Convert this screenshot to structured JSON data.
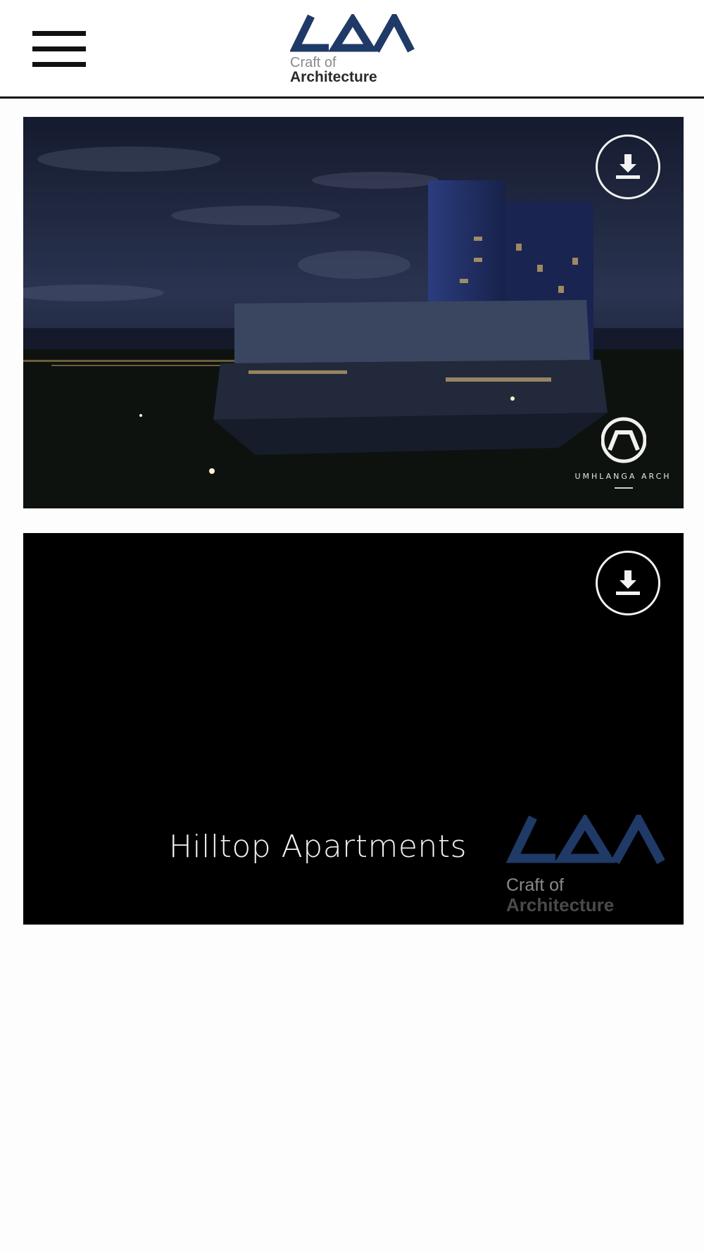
{
  "header": {
    "menu_icon": "hamburger-menu-icon",
    "brand": {
      "line1": "Craft of",
      "line2": "Architecture",
      "color": "#1f3a66"
    }
  },
  "projects": [
    {
      "download_icon": "download-icon",
      "client_logo_text": "UMHLANGA ARCH",
      "title": ""
    },
    {
      "download_icon": "download-icon",
      "title": "Hilltop Apartments",
      "logo": {
        "line1": "Craft of",
        "line2": "Architecture"
      }
    }
  ]
}
